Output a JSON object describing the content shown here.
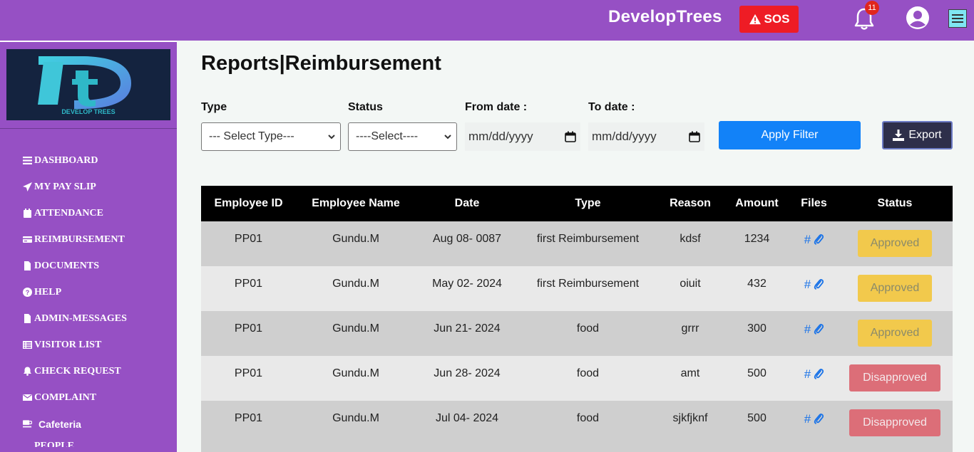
{
  "header": {
    "brand": "DevelopTrees",
    "sos_label": "SOS",
    "notification_count": "11"
  },
  "sidebar": {
    "logo_text": "DEVELOP TREES",
    "items": [
      {
        "label": "DASHBOARD",
        "icon": "list-icon"
      },
      {
        "label": "MY PAY SLIP",
        "icon": "paper-plane-icon"
      },
      {
        "label": "ATTENDANCE",
        "icon": "calendar-icon"
      },
      {
        "label": "REIMBURSEMENT",
        "icon": "credit-card-icon"
      },
      {
        "label": "DOCUMENTS",
        "icon": "file-icon"
      },
      {
        "label": "HELP",
        "icon": "question-circle-icon"
      },
      {
        "label": "ADMIN-MESSAGES",
        "icon": "file-icon"
      },
      {
        "label": "VISITOR LIST",
        "icon": "table-list-icon"
      },
      {
        "label": "CHECK REQUEST",
        "icon": "bell-icon"
      },
      {
        "label": "COMPLAINT",
        "icon": "envelope-icon"
      },
      {
        "label": "Cafeteria",
        "icon": "coffee-cup-icon"
      },
      {
        "label": "PEOPLE",
        "icon": "people-icon"
      }
    ]
  },
  "page": {
    "title": "Reports|Reimbursement"
  },
  "filters": {
    "type_label": "Type",
    "type_value": "--- Select Type---",
    "status_label": "Status",
    "status_value": "----Select----",
    "from_label": "From date :",
    "from_placeholder": "mm/dd/yyyy",
    "to_label": "To date :",
    "to_placeholder": "mm/dd/yyyy",
    "apply_label": "Apply Filter",
    "export_label": "Export"
  },
  "table": {
    "headers": [
      "Employee ID",
      "Employee Name",
      "Date",
      "Type",
      "Reason",
      "Amount",
      "Files",
      "Status"
    ],
    "files_hash": "#",
    "rows": [
      {
        "id": "PP01",
        "name": "Gundu.M",
        "date": "Aug 08- 0087",
        "type": "first Reimbursement",
        "reason": "kdsf",
        "amount": "1234",
        "status": "Approved"
      },
      {
        "id": "PP01",
        "name": "Gundu.M",
        "date": "May 02- 2024",
        "type": "first Reimbursement",
        "reason": "oiuit",
        "amount": "432",
        "status": "Approved"
      },
      {
        "id": "PP01",
        "name": "Gundu.M",
        "date": "Jun 21- 2024",
        "type": "food",
        "reason": "grrr",
        "amount": "300",
        "status": "Approved"
      },
      {
        "id": "PP01",
        "name": "Gundu.M",
        "date": "Jun 28- 2024",
        "type": "food",
        "reason": "amt",
        "amount": "500",
        "status": "Disapproved"
      },
      {
        "id": "PP01",
        "name": "Gundu.M",
        "date": "Jul 04- 2024",
        "type": "food",
        "reason": "sjkfjknf",
        "amount": "500",
        "status": "Disapproved"
      }
    ]
  },
  "colors": {
    "brand_purple": "#9650c4",
    "sos_red": "#ee1c25",
    "apply_blue": "#1282f8",
    "approved": "#f2c94c",
    "disapproved": "#dc6e78"
  }
}
